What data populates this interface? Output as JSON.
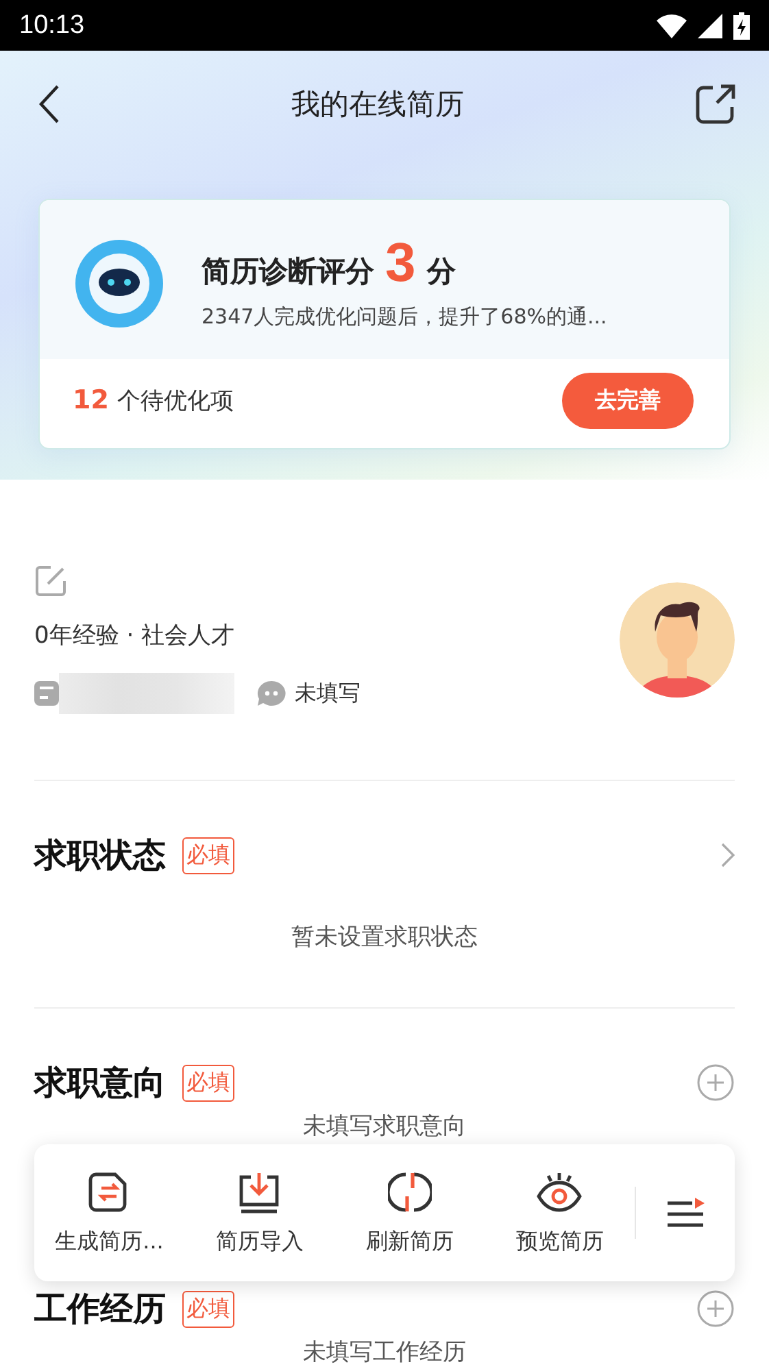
{
  "status_bar": {
    "time": "10:13"
  },
  "header": {
    "title": "我的在线简历"
  },
  "diagnosis": {
    "title": "简历诊断评分",
    "score": "3",
    "unit": "分",
    "subtitle": "2347人完成优化问题后，提升了68%的通...",
    "count": "12",
    "count_label": "个待优化项",
    "button": "去完善"
  },
  "profile": {
    "experience": "0年经验 · 社会人才",
    "wechat": "未填写"
  },
  "sections": [
    {
      "title": "求职状态",
      "badge": "必填",
      "kind": "chevron",
      "empty_text": "暂未设置求职状态"
    },
    {
      "title": "求职意向",
      "badge": "必填",
      "kind": "plus",
      "empty_text": "未填写求职意向"
    },
    {
      "title": "工作经历",
      "badge": "必填",
      "kind": "plus",
      "empty_text": "未填写工作经历"
    }
  ],
  "toolbar": [
    {
      "kind": "generate",
      "label": "生成简历..."
    },
    {
      "kind": "import",
      "label": "简历导入"
    },
    {
      "kind": "refresh",
      "label": "刷新简历"
    },
    {
      "kind": "preview",
      "label": "预览简历"
    }
  ]
}
